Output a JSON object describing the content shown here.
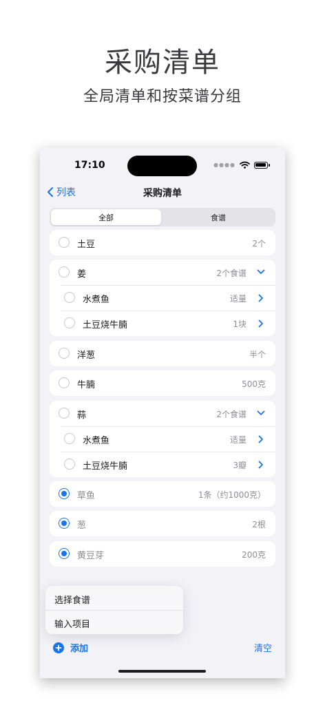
{
  "hero": {
    "title": "采购清单",
    "subtitle": "全局清单和按菜谱分组"
  },
  "status": {
    "time": "17:10"
  },
  "nav": {
    "back_label": "列表",
    "title": "采购清单"
  },
  "segments": [
    {
      "label": "全部",
      "selected": true
    },
    {
      "label": "食谱",
      "selected": false
    }
  ],
  "items": [
    {
      "name": "土豆",
      "qty": "2个"
    },
    {
      "name": "姜",
      "qty": "2个食谱",
      "sub": [
        {
          "name": "水煮鱼",
          "qty": "适量"
        },
        {
          "name": "土豆烧牛腩",
          "qty": "1块"
        }
      ]
    },
    {
      "name": "洋葱",
      "qty": "半个"
    },
    {
      "name": "牛腩",
      "qty": "500克"
    },
    {
      "name": "蒜",
      "qty": "2个食谱",
      "sub": [
        {
          "name": "水煮鱼",
          "qty": "适量"
        },
        {
          "name": "土豆烧牛腩",
          "qty": "3瓣"
        }
      ]
    },
    {
      "name": "草鱼",
      "qty": "1条（约1000克）",
      "checked": true
    },
    {
      "name": "葱",
      "qty": "2根",
      "checked": true
    },
    {
      "name": "黄豆芽",
      "qty": "200克",
      "checked": true
    }
  ],
  "popup": {
    "option1": "选择食谱",
    "option2": "输入项目"
  },
  "toolbar": {
    "add_label": "添加",
    "clear_label": "清空"
  },
  "colors": {
    "accent": "#1a73e8",
    "background": "#f2f2f7"
  }
}
